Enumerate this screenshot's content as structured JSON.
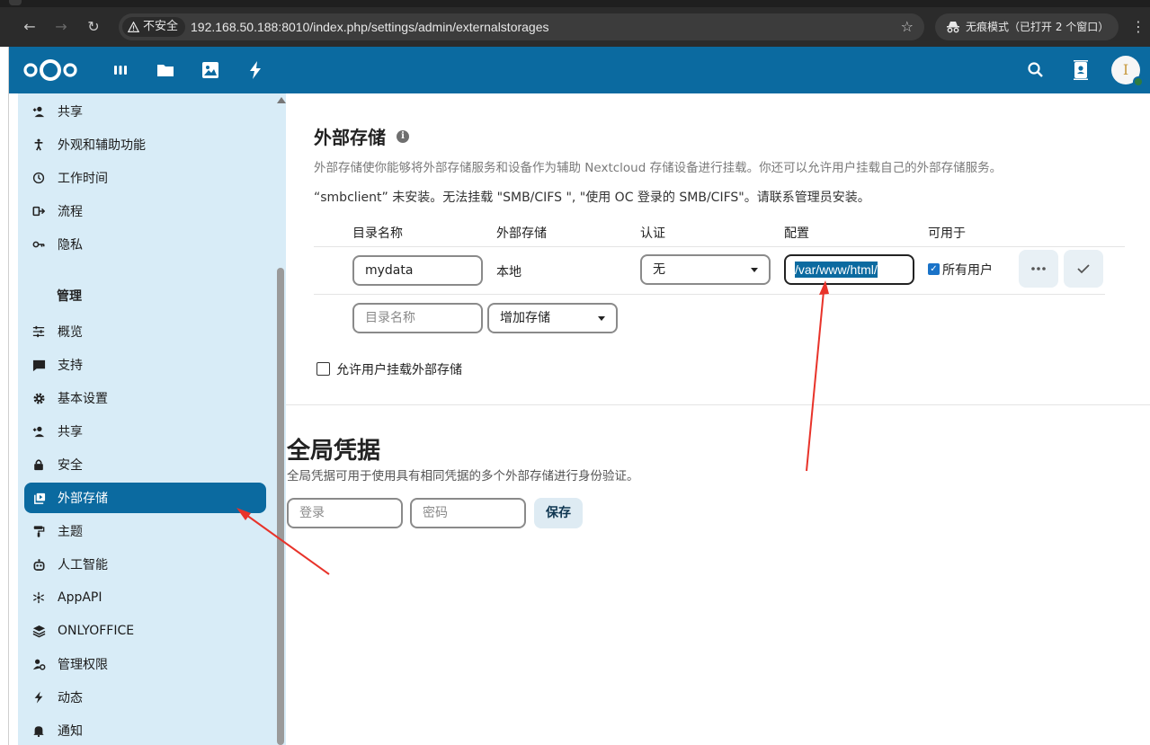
{
  "browser": {
    "back_icon": "←",
    "forward_icon": "→",
    "reload_icon": "↻",
    "security_label": "不安全",
    "url": "192.168.50.188:8010/index.php/settings/admin/externalstorages",
    "bookmark_icon": "☆",
    "incognito_label": "无痕模式（已打开 2 个窗口）",
    "menu_icon": "⋮"
  },
  "header": {
    "apps": [
      "dashboard-icon",
      "files-icon",
      "photos-icon",
      "activity-icon"
    ],
    "avatar_letter": "I",
    "accent_color": "#0b6aa0"
  },
  "sidebar": {
    "personal_items": [
      {
        "label": "共享",
        "icon": "share-icon"
      },
      {
        "label": "外观和辅助功能",
        "icon": "accessibility-icon"
      },
      {
        "label": "工作时间",
        "icon": "clock-icon"
      },
      {
        "label": "流程",
        "icon": "flow-icon"
      },
      {
        "label": "隐私",
        "icon": "key-icon"
      }
    ],
    "admin_heading": "管理",
    "admin_items": [
      {
        "label": "概览",
        "icon": "tune-icon"
      },
      {
        "label": "支持",
        "icon": "chat-icon"
      },
      {
        "label": "基本设置",
        "icon": "gear-icon"
      },
      {
        "label": "共享",
        "icon": "share-icon"
      },
      {
        "label": "安全",
        "icon": "lock-icon"
      },
      {
        "label": "外部存储",
        "icon": "external-storage-icon",
        "active": true
      },
      {
        "label": "主题",
        "icon": "paint-roller-icon"
      },
      {
        "label": "人工智能",
        "icon": "robot-icon"
      },
      {
        "label": "AppAPI",
        "icon": "appapi-icon"
      },
      {
        "label": "ONLYOFFICE",
        "icon": "layers-icon"
      },
      {
        "label": "管理权限",
        "icon": "admin-delegation-icon"
      },
      {
        "label": "动态",
        "icon": "lightning-icon"
      },
      {
        "label": "通知",
        "icon": "bell-icon"
      }
    ]
  },
  "external_storage": {
    "title": "外部存储",
    "description": "外部存储使你能够将外部存储服务和设备作为辅助 Nextcloud 存储设备进行挂载。你还可以允许用户挂载自己的外部存储服务。",
    "warning": "“smbclient” 未安装。无法挂载 \"SMB/CIFS \", \"使用 OC 登录的 SMB/CIFS\"。请联系管理员安装。",
    "columns": [
      "目录名称",
      "外部存储",
      "认证",
      "配置",
      "可用于"
    ],
    "row": {
      "folder": "mydata",
      "backend": "本地",
      "auth": "无",
      "config": "/var/www/html/",
      "available_for": "所有用户",
      "available_checked": true
    },
    "new_row": {
      "folder_placeholder": "目录名称",
      "add_storage": "增加存储"
    },
    "allow_user_mount_label": "允许用户挂载外部存储",
    "allow_user_mount_checked": false
  },
  "global_credentials": {
    "title": "全局凭据",
    "description": "全局凭据可用于使用具有相同凭据的多个外部存储进行身份验证。",
    "login_placeholder": "登录",
    "password_placeholder": "密码",
    "save_label": "保存"
  }
}
